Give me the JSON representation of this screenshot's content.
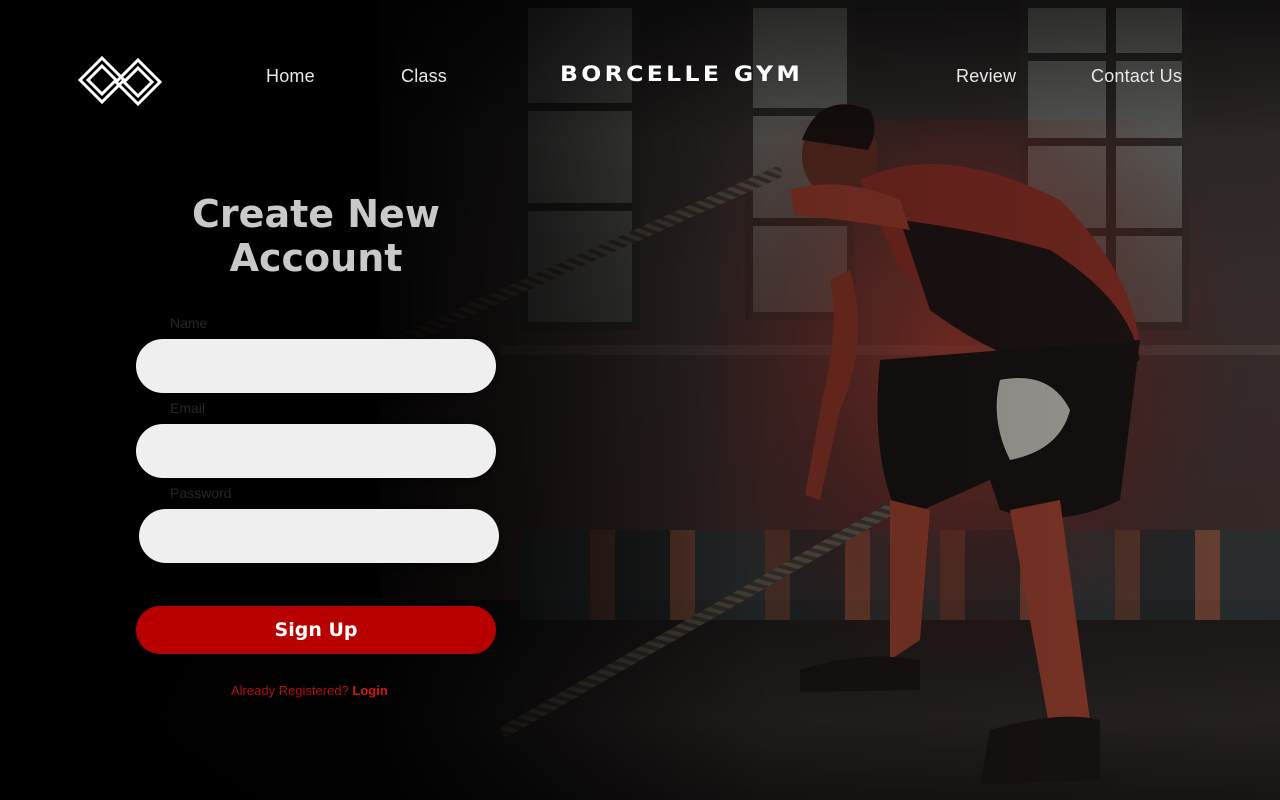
{
  "nav": {
    "brand": "BORCELLE GYM",
    "links": [
      "Home",
      "Class",
      "Review",
      "Contact Us"
    ]
  },
  "form": {
    "title_line1": "Create New",
    "title_line2": "Account",
    "name_label": "Name",
    "email_label": "Email",
    "password_label": "Password",
    "name_value": "",
    "email_value": "",
    "password_value": "",
    "submit_label": "Sign Up",
    "already_text": "Already Registered?",
    "login_label": "Login"
  },
  "colors": {
    "accent": "#b80000",
    "field_bg": "#efefef",
    "title": "#c9c9c9"
  },
  "icons": {
    "logo": "interlocking-diamond-logo-icon"
  }
}
